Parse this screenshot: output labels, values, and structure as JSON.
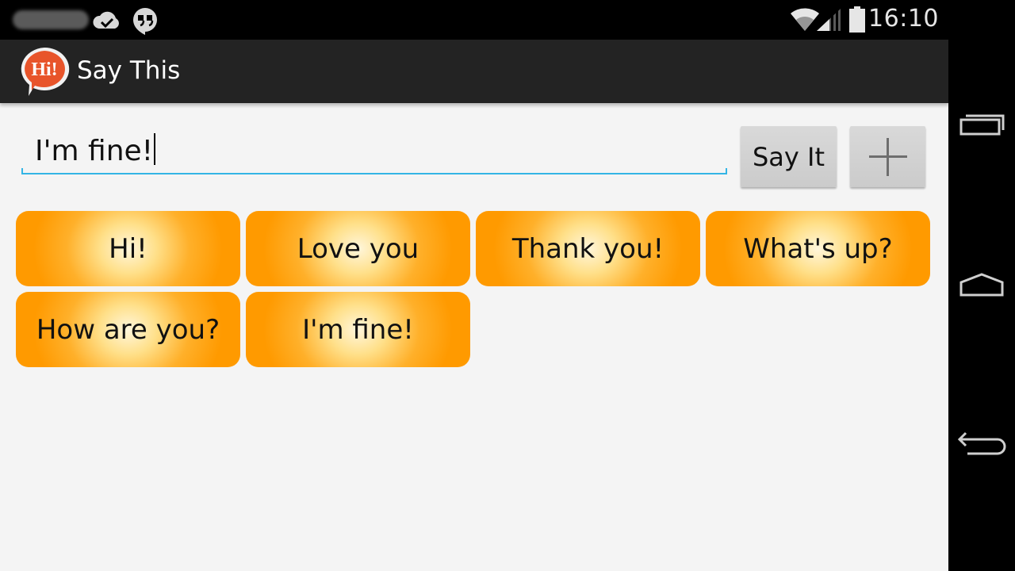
{
  "status_bar": {
    "time": "16:10",
    "icons": [
      "cloud-check-icon",
      "hangouts-icon",
      "wifi-icon",
      "signal-icon",
      "battery-icon"
    ]
  },
  "app": {
    "logo_text": "Hi!",
    "title": "Say This",
    "colors": {
      "action_bar": "#232323",
      "accent": "#33b5e5",
      "phrase_orange": "#ff9a00"
    }
  },
  "input": {
    "value": "I'm fine!"
  },
  "buttons": {
    "say_it": "Say It",
    "add_icon": "plus-icon"
  },
  "phrases": [
    "Hi!",
    "Love you",
    "Thank you!",
    "What's up?",
    "How are you?",
    "I'm fine!"
  ],
  "nav": [
    "recent-apps-icon",
    "home-icon",
    "back-icon"
  ]
}
